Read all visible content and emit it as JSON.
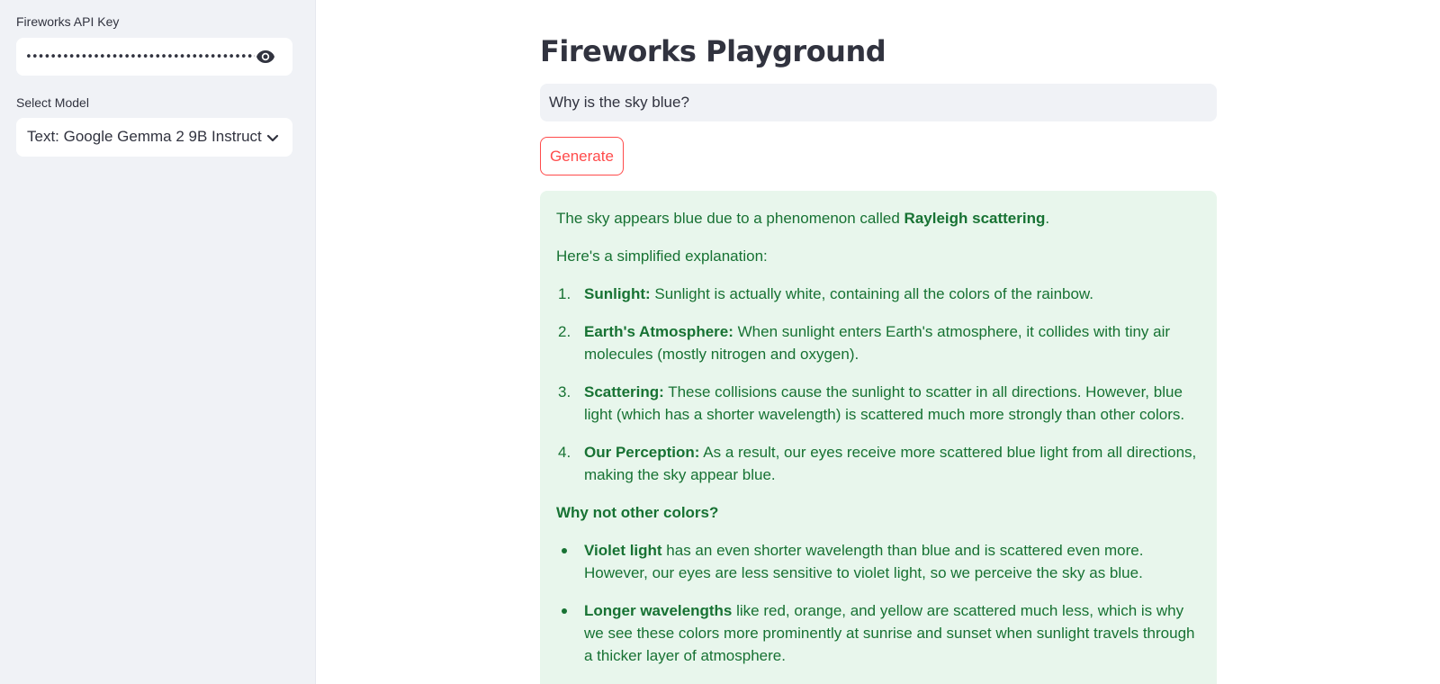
{
  "sidebar": {
    "api_key_label": "Fireworks API Key",
    "api_key_value": "••••••••••••••••••••••••••••••••••••••••••••••••••",
    "model_label": "Select Model",
    "model_value": "Text: Google Gemma 2 9B Instruct",
    "icons": {
      "reveal": "eye-icon",
      "dropdown": "chevron-down-icon"
    }
  },
  "main": {
    "title": "Fireworks Playground",
    "prompt_value": "Why is the sky blue?",
    "generate_label": "Generate",
    "colors": {
      "accent": "#ff4b4b",
      "success_bg": "#e8f6ec",
      "success_text": "#177233",
      "sidebar_bg": "#f0f2f6"
    }
  },
  "response": {
    "intro_text": "The sky appears blue due to a phenomenon called ",
    "intro_bold": "Rayleigh scattering",
    "intro_end": ".",
    "explain": "Here's a simplified explanation:",
    "steps": [
      {
        "num": "1.",
        "bold": "Sunlight:",
        "text": " Sunlight is actually white, containing all the colors of the rainbow."
      },
      {
        "num": "2.",
        "bold": "Earth's Atmosphere:",
        "text": " When sunlight enters Earth's atmosphere, it collides with tiny air molecules (mostly nitrogen and oxygen)."
      },
      {
        "num": "3.",
        "bold": "Scattering:",
        "text": " These collisions cause the sunlight to scatter in all directions. However, blue light (which has a shorter wavelength) is scattered much more strongly than other colors."
      },
      {
        "num": "4.",
        "bold": "Our Perception:",
        "text": " As a result, our eyes receive more scattered blue light from all directions, making the sky appear blue."
      }
    ],
    "why_heading": "Why not other colors?",
    "bullets": [
      {
        "bold": "Violet light",
        "text": " has an even shorter wavelength than blue and is scattered even more. However, our eyes are less sensitive to violet light, so we perceive the sky as blue."
      },
      {
        "bold": "Longer wavelengths",
        "text": " like red, orange, and yellow are scattered much less, which is why we see these colors more prominently at sunrise and sunset when sunlight travels through a thicker layer of atmosphere."
      }
    ]
  }
}
